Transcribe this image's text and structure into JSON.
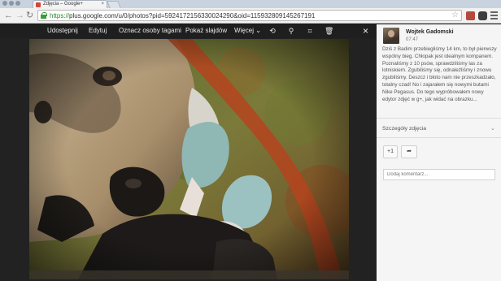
{
  "browser": {
    "tab_title": "Zdjęcia – Google+",
    "url_scheme": "https://",
    "url_rest": "plus.google.com/u/0/photos?pid=5924172156330024290&oid=115932809145267191",
    "tab_close": "×"
  },
  "viewer": {
    "actions": [
      "Udostępnij",
      "Edytuj",
      "Oznacz osoby tagami",
      "Pokaż slajdów",
      "Więcej"
    ],
    "close": "×"
  },
  "panel": {
    "author": "Wojtek Gadomski",
    "time": "07:47",
    "post": "Dziś z Badim przebiegliśmy 14 km, to był pierwszy wspólny bieg. Chłopak jest idealnym kompanem. Poznaliśmy z 10 psów, sprawdziliśmy las za lotniskiem. Zgubiliśmy się, odnaleźliśmy i znowu zgubiliśmy. Deszcz i błoto nam nie przeszkadzało, totalny czad! No i zajarałem się nowymi butami Nike Pegasus. Do tego wypróbowałem nowy edytor zdjęć w g+, jak widać na obrazku...",
    "details_label": "Szczegóły zdjęcia",
    "plus_one": "+1",
    "comment_placeholder": "Dodaj komentarz..."
  },
  "colors": {
    "brand": "#d14836",
    "toolbar_bg": "#f1f1f1",
    "viewer_bg": "#222222",
    "panel_bg": "#f5f5f5"
  }
}
